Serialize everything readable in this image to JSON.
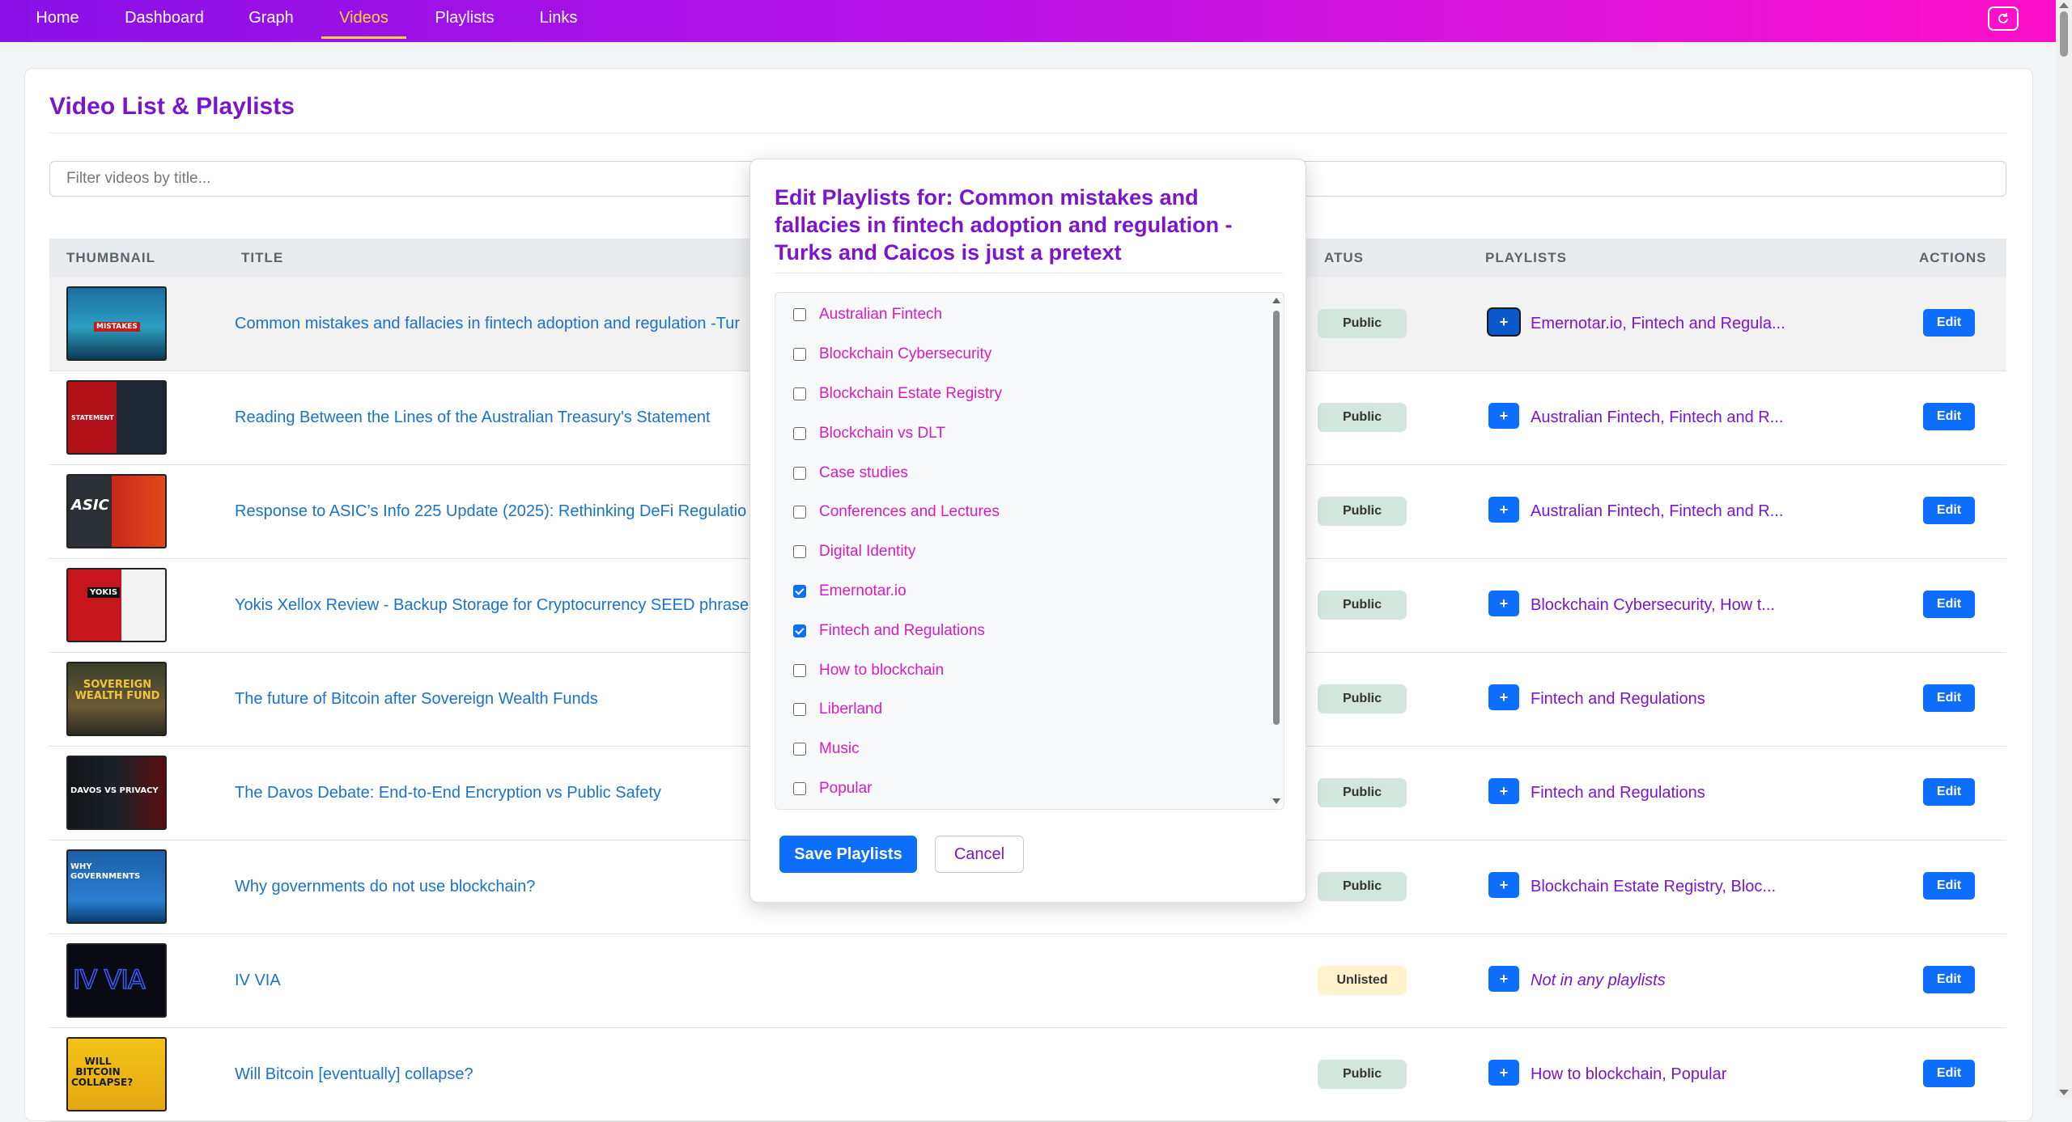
{
  "nav": {
    "items": [
      {
        "label": "Home"
      },
      {
        "label": "Dashboard"
      },
      {
        "label": "Graph"
      },
      {
        "label": "Videos",
        "active": true
      },
      {
        "label": "Playlists"
      },
      {
        "label": "Links"
      }
    ],
    "refresh_icon": "refresh-icon"
  },
  "page": {
    "title": "Video List & Playlists",
    "filter_placeholder": "Filter videos by title..."
  },
  "table": {
    "headers": {
      "thumbnail": "THUMBNAIL",
      "title": "TITLE",
      "status": "ATUS",
      "playlists": "PLAYLISTS",
      "actions": "ACTIONS"
    },
    "rows": [
      {
        "title": "Common mistakes and fallacies in fintech adoption and regulation -Tur",
        "status": "Public",
        "playlists": "Emernotar.io, Fintech and Regula...",
        "thumb_text": "MISTAKES"
      },
      {
        "title": "Reading Between the Lines of the Australian Treasury's Statement",
        "status": "Public",
        "playlists": "Australian Fintech, Fintech and R...",
        "thumb_text": "STATEMENT"
      },
      {
        "title": "Response to ASIC’s Info 225 Update (2025): Rethinking DeFi Regulatio",
        "status": "Public",
        "playlists": "Australian Fintech, Fintech and R...",
        "thumb_text": "ASIC"
      },
      {
        "title": "Yokis Xellox Review - Backup Storage for Cryptocurrency SEED phrase",
        "status": "Public",
        "playlists": "Blockchain Cybersecurity, How t...",
        "thumb_text": "YOKIS"
      },
      {
        "title": "The future of Bitcoin after Sovereign Wealth Funds",
        "status": "Public",
        "playlists": "Fintech and Regulations",
        "thumb_text": "SOVEREIGN WEALTH FUND"
      },
      {
        "title": "The Davos Debate: End-to-End Encryption vs Public Safety",
        "status": "Public",
        "playlists": "Fintech and Regulations",
        "thumb_text": "DAVOS VS PRIVACY"
      },
      {
        "title": "Why governments do not use blockchain?",
        "status": "Public",
        "playlists": "Blockchain Estate Registry, Bloc...",
        "thumb_text": "WHY GOVERNMENTS"
      },
      {
        "title": "IV VIA",
        "status": "Unlisted",
        "playlists": "Not in any playlists",
        "thumb_text": "IV VIA"
      },
      {
        "title": "Will Bitcoin [eventually] collapse?",
        "status": "Public",
        "playlists": "How to blockchain, Popular",
        "thumb_text": "WILL BITCOIN COLLAPSE?"
      }
    ],
    "plus_label": "+",
    "edit_label": "Edit"
  },
  "modal": {
    "title": "Edit Playlists for: Common mistakes and fallacies in fintech adoption and regulation -Turks and Caicos is just a pretext",
    "items": [
      {
        "label": "Australian Fintech",
        "checked": false
      },
      {
        "label": "Blockchain Cybersecurity",
        "checked": false
      },
      {
        "label": "Blockchain Estate Registry",
        "checked": false
      },
      {
        "label": "Blockchain vs DLT",
        "checked": false
      },
      {
        "label": "Case studies",
        "checked": false
      },
      {
        "label": "Conferences and Lectures",
        "checked": false
      },
      {
        "label": "Digital Identity",
        "checked": false
      },
      {
        "label": "Emernotar.io",
        "checked": true
      },
      {
        "label": "Fintech and Regulations",
        "checked": true
      },
      {
        "label": "How to blockchain",
        "checked": false
      },
      {
        "label": "Liberland",
        "checked": false
      },
      {
        "label": "Music",
        "checked": false
      },
      {
        "label": "Popular",
        "checked": false
      }
    ],
    "save_label": "Save Playlists",
    "cancel_label": "Cancel"
  },
  "colors": {
    "accent": "#7b16cc",
    "link": "#1a73c8",
    "button": "#0d6efd",
    "nav_active": "#ffd23c",
    "public_badge": "#d1e7dd",
    "unlisted_badge": "#fff3cd"
  }
}
